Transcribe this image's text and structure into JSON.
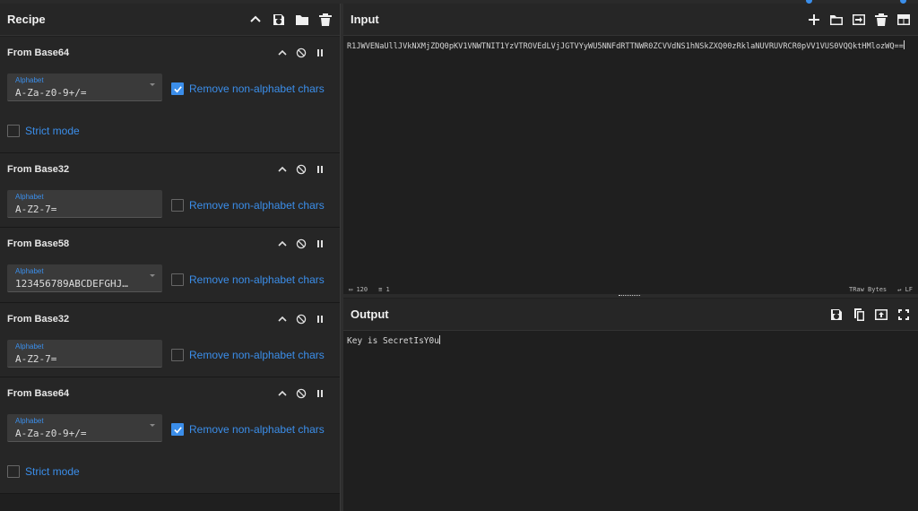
{
  "recipe": {
    "title": "Recipe",
    "operations": [
      {
        "name": "From Base64",
        "alphabet_label": "Alphabet",
        "alphabet_value": "A-Za-z0-9+/=",
        "remove_label": "Remove non-alphabet chars",
        "remove_checked": true,
        "strict_label": "Strict mode",
        "strict_checked": false
      },
      {
        "name": "From Base32",
        "alphabet_label": "Alphabet",
        "alphabet_value": "A-Z2-7=",
        "remove_label": "Remove non-alphabet chars",
        "remove_checked": false
      },
      {
        "name": "From Base58",
        "alphabet_label": "Alphabet",
        "alphabet_value": "123456789ABCDEFGHJ…",
        "remove_label": "Remove non-alphabet chars",
        "remove_checked": false
      },
      {
        "name": "From Base32",
        "alphabet_label": "Alphabet",
        "alphabet_value": "A-Z2-7=",
        "remove_label": "Remove non-alphabet chars",
        "remove_checked": false
      },
      {
        "name": "From Base64",
        "alphabet_label": "Alphabet",
        "alphabet_value": "A-Za-z0-9+/=",
        "remove_label": "Remove non-alphabet chars",
        "remove_checked": true,
        "strict_label": "Strict mode",
        "strict_checked": false
      }
    ]
  },
  "input": {
    "title": "Input",
    "text": "R1JWVENaUllJVkNXMjZDQ0pKV1VNWTNIT1YzVTROVEdLVjJGTVYyWU5NNFdRTTNWR0ZCVVdNS1hNSkZXQ00zRklaNUVRUVRCR0pVV1VUS0VQQktHMlozWQ==",
    "stats_length": "120",
    "stats_lines": "1",
    "encoding": "Raw Bytes",
    "eol": "LF"
  },
  "output": {
    "title": "Output",
    "text": "Key is SecretIsY0u"
  },
  "colors": {
    "accent": "#3b8eea",
    "panel_bg": "#1f1f1f",
    "header_bg": "#262626"
  }
}
